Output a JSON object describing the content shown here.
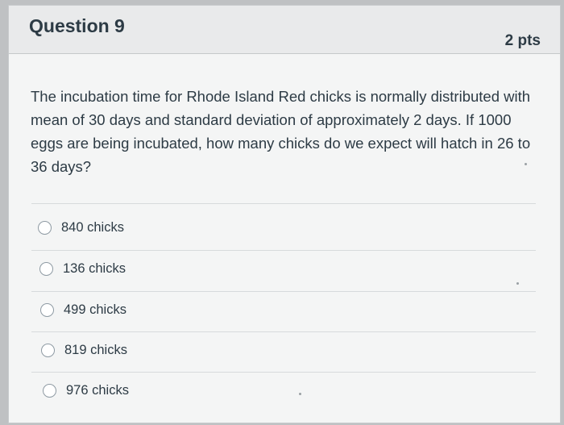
{
  "question": {
    "title": "Question 9",
    "points": "2 pts",
    "text": "The incubation time for Rhode Island Red chicks is normally distributed with mean of 30 days and standard deviation of approximately 2 days. If 1000 eggs are being incubated, how many chicks do we expect will hatch in 26 to 36 days?"
  },
  "answers": [
    {
      "label": "840 chicks"
    },
    {
      "label": "136 chicks"
    },
    {
      "label": "499 chicks"
    },
    {
      "label": "819 chicks"
    },
    {
      "label": "976 chicks"
    }
  ],
  "colors": {
    "text": "#2d3b45",
    "header_bg": "#e9eaeb",
    "card_bg": "#f4f5f5",
    "divider": "#d7dadc",
    "radio_border": "#8e9aa3"
  }
}
